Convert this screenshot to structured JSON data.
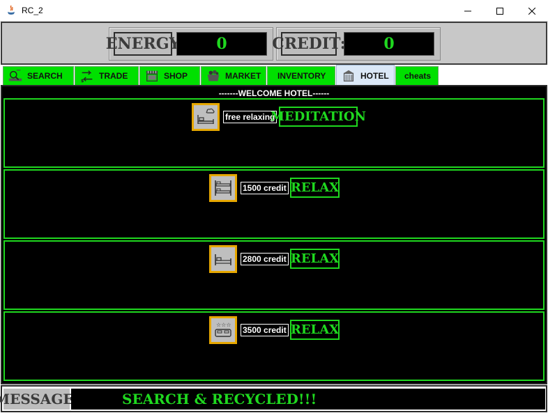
{
  "window": {
    "title": "RC_2",
    "controls": {
      "minimize": "—",
      "maximize": "☐",
      "close": "✕"
    }
  },
  "stats": {
    "energy_label": "ENERGY",
    "energy_value": "0",
    "credit_label": "CREDIT:",
    "credit_value": "0"
  },
  "tabs": [
    {
      "label": "SEARCH",
      "icon": "search-icon",
      "active": false
    },
    {
      "label": "TRADE",
      "icon": "trade-icon",
      "active": false
    },
    {
      "label": "SHOP",
      "icon": "shop-icon",
      "active": false
    },
    {
      "label": "MARKET",
      "icon": "market-icon",
      "active": false
    },
    {
      "label": "INVENTORY",
      "icon": "",
      "active": false
    },
    {
      "label": "HOTEL",
      "icon": "hotel-icon",
      "active": true
    },
    {
      "label": "cheats",
      "icon": "",
      "active": false
    }
  ],
  "hotel": {
    "welcome": "-------WELCOME HOTEL------",
    "rooms": [
      {
        "icon": "meditation-bed-icon",
        "price": "free relaxing",
        "button": "MEDITATION"
      },
      {
        "icon": "bunk-bed-icon",
        "price": "1500 credit",
        "button": "RELAX"
      },
      {
        "icon": "single-bed-icon",
        "price": "2800 credit",
        "button": "RELAX"
      },
      {
        "icon": "luxury-bed-icon",
        "price": "3500 credit",
        "button": "RELAX"
      }
    ]
  },
  "message": {
    "label": "MESSAGE:",
    "value": "SEARCH & RECYCLED!!!"
  },
  "colors": {
    "accent_green": "#1fd81f",
    "tab_green": "#00e000",
    "icon_border": "#e6a700",
    "panel_gray": "#c8c8c8"
  }
}
